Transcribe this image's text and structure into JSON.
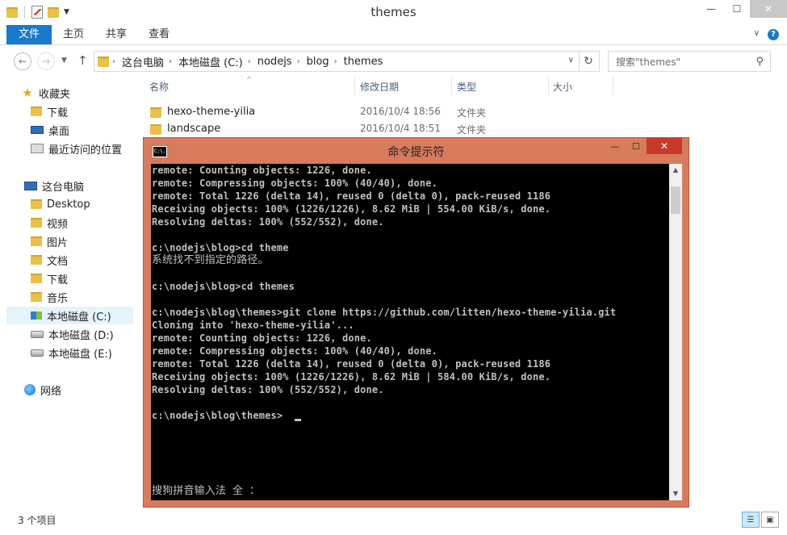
{
  "explorer": {
    "title": "themes",
    "ribbon_tabs": [
      "文件",
      "主页",
      "共享",
      "查看"
    ],
    "address": {
      "crumbs": [
        "这台电脑",
        "本地磁盘 (C:)",
        "nodejs",
        "blog",
        "themes"
      ]
    },
    "search_placeholder": "搜索\"themes\"",
    "sidebar": {
      "favorites": "收藏夹",
      "favorites_items": [
        "下载",
        "桌面",
        "最近访问的位置"
      ],
      "this_pc": "这台电脑",
      "pc_items": [
        "Desktop",
        "视频",
        "图片",
        "文档",
        "下载",
        "音乐",
        "本地磁盘 (C:)",
        "本地磁盘 (D:)",
        "本地磁盘 (E:)"
      ],
      "network": "网络"
    },
    "columns": [
      "名称",
      "修改日期",
      "类型",
      "大小"
    ],
    "files": [
      {
        "name": "hexo-theme-yilia",
        "date": "2016/10/4 18:56",
        "type": "文件夹"
      },
      {
        "name": "landscape",
        "date": "2016/10/4 18:51",
        "type": "文件夹"
      }
    ],
    "status": "3 个项目"
  },
  "cmd": {
    "title": "命令提示符",
    "icon_text": "C:\\.",
    "lines": [
      "remote: Counting objects: 1226, done.",
      "remote: Compressing objects: 100% (40/40), done.",
      "remote: Total 1226 (delta 14), reused 0 (delta 0), pack-reused 1186",
      "Receiving objects: 100% (1226/1226), 8.62 MiB | 554.00 KiB/s, done.",
      "Resolving deltas: 100% (552/552), done.",
      "",
      "c:\\nodejs\\blog>cd theme",
      "系统找不到指定的路径。",
      "",
      "c:\\nodejs\\blog>cd themes",
      "",
      "c:\\nodejs\\blog\\themes>git clone https://github.com/litten/hexo-theme-yilia.git",
      "Cloning into 'hexo-theme-yilia'...",
      "remote: Counting objects: 1226, done.",
      "remote: Compressing objects: 100% (40/40), done.",
      "remote: Total 1226 (delta 14), reused 0 (delta 0), pack-reused 1186",
      "Receiving objects: 100% (1226/1226), 8.62 MiB | 584.00 KiB/s, done.",
      "Resolving deltas: 100% (552/552), done.",
      "",
      "c:\\nodejs\\blog\\themes>"
    ],
    "ime_status": "搜狗拼音输入法 全 ："
  }
}
